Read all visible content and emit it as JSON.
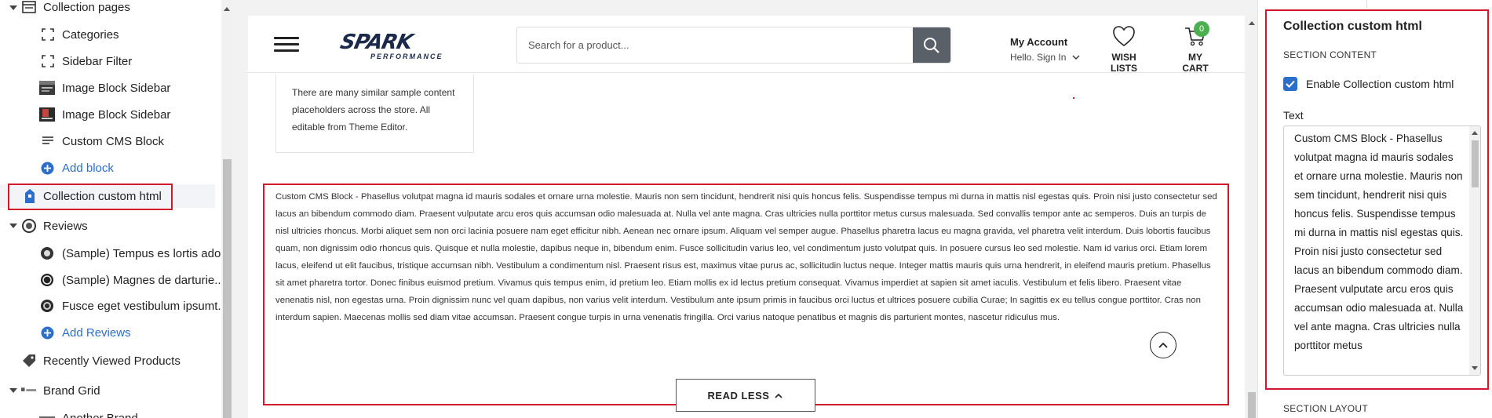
{
  "sidebar": {
    "collection_pages_label": "Collection pages",
    "items": [
      {
        "label": "Categories",
        "icon": "section-icon"
      },
      {
        "label": "Sidebar Filter",
        "icon": "section-icon"
      },
      {
        "label": "Image Block Sidebar",
        "icon": "image-block-icon"
      },
      {
        "label": "Image Block Sidebar",
        "icon": "image-block-icon"
      },
      {
        "label": "Custom CMS Block",
        "icon": "text-lines-icon"
      }
    ],
    "add_block_label": "Add block",
    "selected_label": "Collection custom html",
    "reviews_label": "Reviews",
    "review_items": [
      {
        "label": "(Sample) Tempus es lortis ado..."
      },
      {
        "label": "(Sample) Magnes de darturie..."
      },
      {
        "label": "Fusce eget vestibulum ipsumt..."
      }
    ],
    "add_reviews_label": "Add Reviews",
    "recently_viewed_label": "Recently Viewed Products",
    "brand_grid_label": "Brand Grid",
    "another_brand_label": "Another Brand"
  },
  "store": {
    "logo_main": "SPARK",
    "logo_sub": "PERFORMANCE",
    "search_placeholder": "Search for a product...",
    "account_title": "My Account",
    "account_sub": "Hello. Sign In",
    "wishlist_label": "WISH LISTS",
    "cart_label": "MY CART",
    "cart_count": "0",
    "promo_text": "There are many similar sample content placeholders across the store. All editable from Theme Editor.",
    "cms_text": "Custom CMS Block - Phasellus volutpat magna id mauris sodales et ornare urna molestie. Mauris non sem tincidunt, hendrerit nisi quis honcus felis. Suspendisse tempus mi durna in mattis nisl egestas quis. Proin nisi justo consectetur sed lacus an bibendum commodo diam. Praesent vulputate arcu eros quis accumsan odio malesuada at. Nulla vel ante magna. Cras ultricies nulla porttitor metus cursus malesuada. Sed convallis tempor ante ac semperos. Duis an turpis de nisl ultricies rhoncus. Morbi aliquet sem non orci lacinia posuere nam eget efficitur nibh. Aenean nec ornare ipsum. Aliquam vel semper augue. Phasellus pharetra lacus eu magna gravida, vel pharetra velit interdum. Duis lobortis faucibus quam, non dignissim odio rhoncus quis. Quisque et nulla molestie, dapibus neque in, bibendum enim. Fusce sollicitudin varius leo, vel condimentum justo volutpat quis. In posuere cursus leo sed molestie. Nam id varius orci. Etiam lorem lacus, eleifend ut elit faucibus, tristique accumsan nibh. Vestibulum a condimentum nisl. Praesent risus est, maximus vitae purus ac, sollicitudin luctus neque. Integer mattis mauris quis urna hendrerit, in eleifend mauris pretium. Phasellus sit amet pharetra tortor. Donec finibus euismod pretium. Vivamus quis tempus enim, id pretium leo. Etiam mollis ex id lectus pretium consequat. Vivamus imperdiet at sapien sit amet iaculis. Vestibulum et felis libero. Praesent vitae venenatis nisl, non egestas urna. Proin dignissim nunc vel quam dapibus, non varius velit interdum. Vestibulum ante ipsum primis in faucibus orci luctus et ultrices posuere cubilia Curae; In sagittis ex eu tellus congue porttitor. Cras non interdum sapien. Maecenas mollis sed diam vitae accumsan. Praesent congue turpis in urna venenatis fringilla. Orci varius natoque penatibus et magnis dis parturient montes, nascetur ridiculus mus.",
    "read_less_label": "READ LESS"
  },
  "panel": {
    "title": "Collection custom html",
    "section_content": "SECTION CONTENT",
    "enable_label": "Enable Collection custom html",
    "enabled": true,
    "text_label": "Text",
    "text_value": "Custom CMS Block - Phasellus volutpat magna id mauris sodales et ornare urna molestie. Mauris non sem tincidunt, hendrerit nisi quis honcus felis. Suspendisse tempus mi durna in mattis nisl egestas quis. Proin nisi justo consectetur sed lacus an bibendum commodo diam. Praesent vulputate arcu eros quis accumsan odio malesuada at. Nulla vel ante magna. Cras ultricies nulla porttitor metus",
    "section_layout": "SECTION LAYOUT"
  },
  "colors": {
    "accent_blue": "#2c6ecb",
    "highlight_red": "#d1192b",
    "cart_badge_green": "#4caf50"
  }
}
